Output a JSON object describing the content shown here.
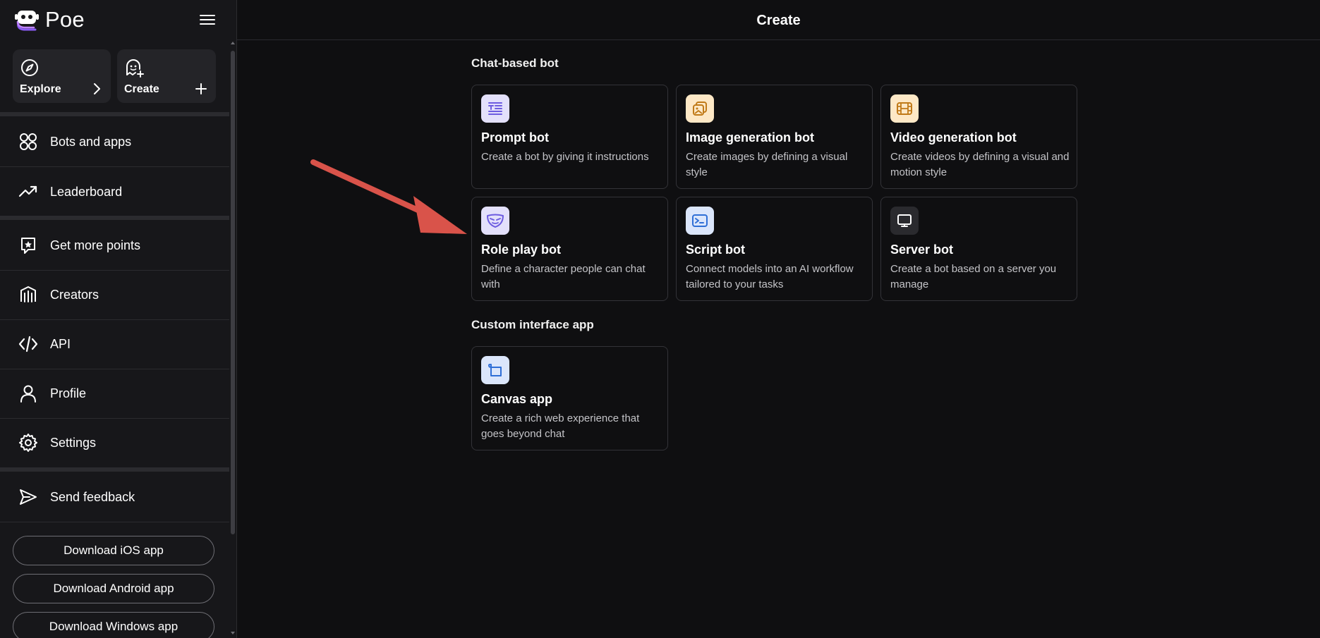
{
  "brand": {
    "name": "Poe"
  },
  "quick_actions": {
    "explore": {
      "label": "Explore"
    },
    "create": {
      "label": "Create"
    }
  },
  "nav": [
    {
      "label": "Bots and apps",
      "icon": "bots-grid-icon"
    },
    {
      "label": "Leaderboard",
      "icon": "trending-up-icon"
    },
    {
      "label": "Get more points",
      "icon": "star-badge-icon"
    },
    {
      "label": "Creators",
      "icon": "creators-icon"
    },
    {
      "label": "API",
      "icon": "code-icon"
    },
    {
      "label": "Profile",
      "icon": "user-icon"
    },
    {
      "label": "Settings",
      "icon": "gear-icon"
    },
    {
      "label": "Send feedback",
      "icon": "send-icon"
    }
  ],
  "downloads": {
    "ios": "Download iOS app",
    "android": "Download Android app",
    "windows": "Download Windows app"
  },
  "header": {
    "title": "Create"
  },
  "sections": {
    "chat_based": {
      "title": "Chat-based bot",
      "cards": [
        {
          "title": "Prompt bot",
          "desc": "Create a bot by giving it instructions",
          "icon": "text-lines-icon",
          "color": "#e3e0fb"
        },
        {
          "title": "Image generation bot",
          "desc": "Create images by defining a visual style",
          "icon": "image-icon",
          "color": "#fde8c6"
        },
        {
          "title": "Video generation bot",
          "desc": "Create videos by defining a visual and motion style",
          "icon": "film-icon",
          "color": "#fde8c6"
        },
        {
          "title": "Role play bot",
          "desc": "Define a character people can chat with",
          "icon": "mask-icon",
          "color": "#e3e0fb"
        },
        {
          "title": "Script bot",
          "desc": "Connect models into an AI workflow tailored to your tasks",
          "icon": "terminal-icon",
          "color": "#dbe6fb"
        },
        {
          "title": "Server bot",
          "desc": "Create a bot based on a server you manage",
          "icon": "monitor-icon",
          "color": "#2a2a2e"
        }
      ]
    },
    "custom_interface": {
      "title": "Custom interface app",
      "cards": [
        {
          "title": "Canvas app",
          "desc": "Create a rich web experience that goes beyond chat",
          "icon": "canvas-icon",
          "color": "#dbe6fb"
        }
      ]
    }
  },
  "colors": {
    "background": "#0f0f11",
    "sidebar": "#17171a",
    "border": "#333338",
    "annotation_arrow": "#d9534a"
  }
}
